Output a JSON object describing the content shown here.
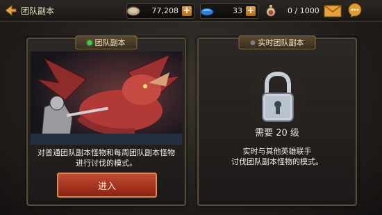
{
  "header": {
    "title": "团队副本"
  },
  "resources": {
    "silver": "77,208",
    "gems": "33",
    "potion": "0 / 1000"
  },
  "panels": {
    "left": {
      "tab_label": "团队副本",
      "description_line1": "对普通团队副本怪物和每周团队副本怪物",
      "description_line2": "进行讨伐的模式。",
      "enter_label": "进入"
    },
    "right": {
      "tab_label": "实时团队副本",
      "requirement": "需要 20 级",
      "description_line1": "实时与其他英雄联手",
      "description_line2": "讨伐团队副本怪物的模式。"
    }
  },
  "icons": {
    "back": "back-arrow-icon",
    "silver": "silver-coin-icon",
    "gems": "gem-icon",
    "potion": "potion-icon",
    "mail": "mail-icon",
    "chat": "chat-icon",
    "lock": "lock-icon"
  }
}
